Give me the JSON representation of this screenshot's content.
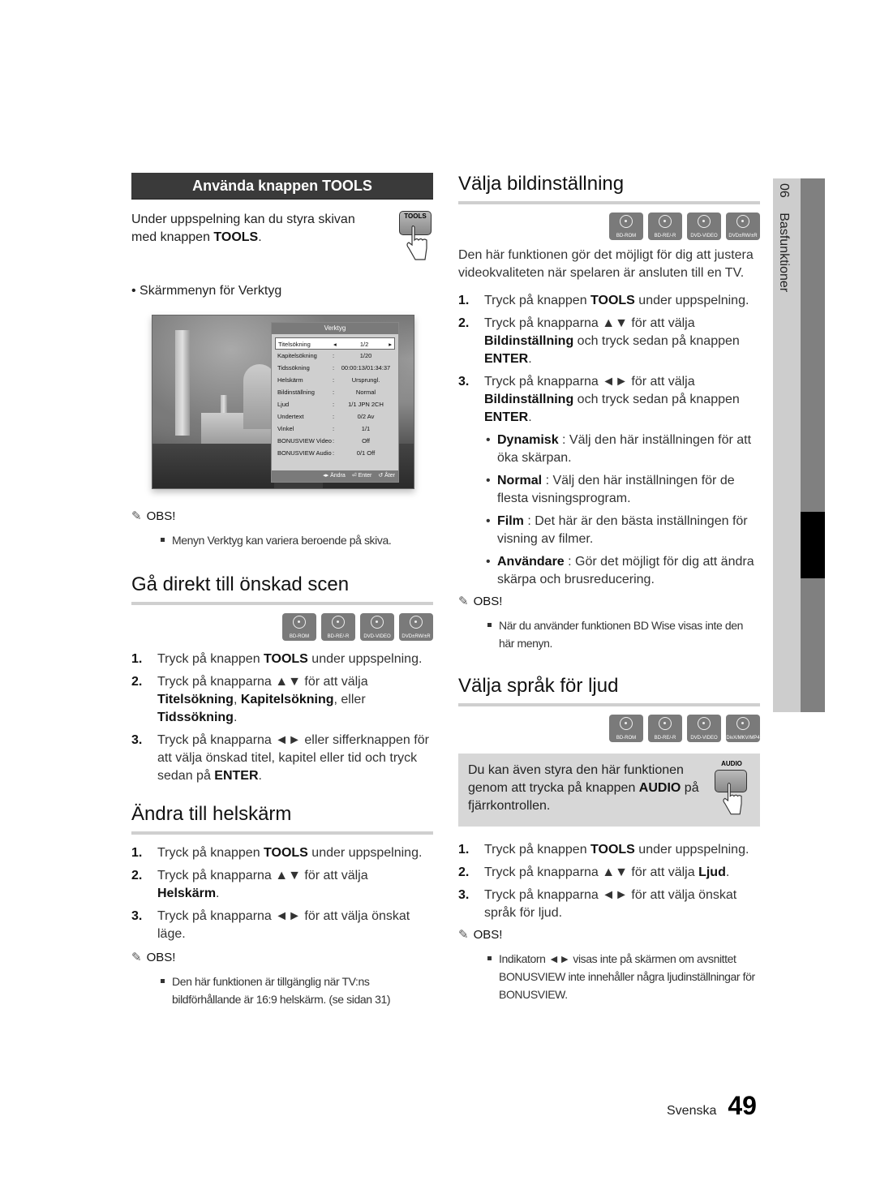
{
  "side_tab": {
    "chapter_number": "06",
    "chapter_title": "Basfunktioner"
  },
  "footer": {
    "language": "Svenska",
    "page_number": "49"
  },
  "tools_section": {
    "header": "Använda knappen TOOLS",
    "intro_pre": "Under uppspelning kan du styra skivan med knappen ",
    "intro_bold": "TOOLS",
    "intro_post": ".",
    "remote_button_label": "TOOLS",
    "bullet": "Skärmmenyn för Verktyg",
    "screen_menu": {
      "title": "Verktyg",
      "rows": [
        {
          "key": "Titelsökning",
          "sep": "◂",
          "value": "1/2",
          "end": "▸",
          "selected": true
        },
        {
          "key": "Kapitelsökning",
          "sep": ":",
          "value": "1/20"
        },
        {
          "key": "Tidssökning",
          "sep": ":",
          "value": "00:00:13/01:34:37"
        },
        {
          "key": "Helskärm",
          "sep": ":",
          "value": "Ursprungl."
        },
        {
          "key": "Bildinställning",
          "sep": ":",
          "value": "Normal"
        },
        {
          "key": "Ljud",
          "sep": ":",
          "value": "1/1 JPN 2CH"
        },
        {
          "key": "Undertext",
          "sep": ":",
          "value": "0/2 Av"
        },
        {
          "key": "Vinkel",
          "sep": ":",
          "value": "1/1"
        },
        {
          "key": "BONUSVIEW Video",
          "sep": ":",
          "value": "Off"
        },
        {
          "key": "BONUSVIEW Audio",
          "sep": ":",
          "value": "0/1 Off"
        }
      ],
      "footer": {
        "change": "◂▸ Ändra",
        "enter": "⏎ Enter",
        "back": "↺ Åter"
      }
    },
    "obs_label": "OBS!",
    "obs_note": "Menyn Verktyg kan variera beroende på skiva."
  },
  "scene_section": {
    "title": "Gå direkt till önskad scen",
    "discs": [
      "BD-ROM",
      "BD-RE/-R",
      "DVD-VIDEO",
      "DVD±RW/±R"
    ],
    "steps": [
      {
        "n": "1.",
        "html": "Tryck på knappen <b>TOOLS</b> under uppspelning."
      },
      {
        "n": "2.",
        "html": "Tryck på knapparna ▲▼ för att välja <b>Titelsökning</b>, <b>Kapitelsökning</b>, eller <b>Tidssökning</b>."
      },
      {
        "n": "3.",
        "html": "Tryck på knapparna ◄► eller sifferknappen för att välja önskad titel, kapitel eller tid och tryck sedan på <b>ENTER</b>."
      }
    ]
  },
  "fullscreen_section": {
    "title": "Ändra till helskärm",
    "steps": [
      {
        "n": "1.",
        "html": "Tryck på knappen <b>TOOLS</b> under uppspelning."
      },
      {
        "n": "2.",
        "html": "Tryck på knapparna ▲▼ för att välja <b>Helskärm</b>."
      },
      {
        "n": "3.",
        "html": "Tryck på knapparna ◄► för att välja önskat läge."
      }
    ],
    "obs_label": "OBS!",
    "obs_note": "Den här funktionen är tillgänglig när TV:ns bildförhållande är 16:9 helskärm. (se sidan 31)"
  },
  "picture_section": {
    "title": "Välja bildinställning",
    "discs": [
      "BD-ROM",
      "BD-RE/-R",
      "DVD-VIDEO",
      "DVD±RW/±R"
    ],
    "intro": "Den här funktionen gör det möjligt för dig att justera videokvaliteten när spelaren är ansluten till en TV.",
    "steps": [
      {
        "n": "1.",
        "html": "Tryck på knappen <b>TOOLS</b> under uppspelning."
      },
      {
        "n": "2.",
        "html": "Tryck på knapparna ▲▼ för att välja <b>Bildinställning</b> och tryck sedan på knappen <b>ENTER</b>."
      },
      {
        "n": "3.",
        "html": "Tryck på knapparna ◄► för att välja <b>Bildinställning</b> och tryck sedan på knappen <b>ENTER</b>."
      }
    ],
    "options": [
      {
        "html": "<b>Dynamisk</b> : Välj den här inställningen för att öka skärpan."
      },
      {
        "html": "<b>Normal</b> : Välj den här inställningen för de flesta visningsprogram."
      },
      {
        "html": "<b>Film</b> : Det här är den bästa inställningen för visning av filmer."
      },
      {
        "html": "<b>Användare</b> : Gör det möjligt för dig att ändra skärpa och brusreducering."
      }
    ],
    "obs_label": "OBS!",
    "obs_note": "När du använder funktionen BD Wise visas inte den här menyn."
  },
  "audio_section": {
    "title": "Välja språk för ljud",
    "discs": [
      "BD-ROM",
      "BD-RE/-R",
      "DVD-VIDEO",
      "DivX/MKV/MP4"
    ],
    "info_html": "Du kan även styra den här funktionen genom att trycka på knappen <b>AUDIO</b> på fjärrkontrollen.",
    "remote_button_label": "AUDIO",
    "steps": [
      {
        "n": "1.",
        "html": "Tryck på knappen <b>TOOLS</b> under uppspelning."
      },
      {
        "n": "2.",
        "html": "Tryck på knapparna ▲▼ för att välja <b>Ljud</b>."
      },
      {
        "n": "3.",
        "html": "Tryck på knapparna ◄► för att välja önskat språk för ljud."
      }
    ],
    "obs_label": "OBS!",
    "obs_note": "Indikatorn ◄► visas inte på skärmen om avsnittet BONUSVIEW inte innehåller några ljudinställningar för BONUSVIEW."
  }
}
